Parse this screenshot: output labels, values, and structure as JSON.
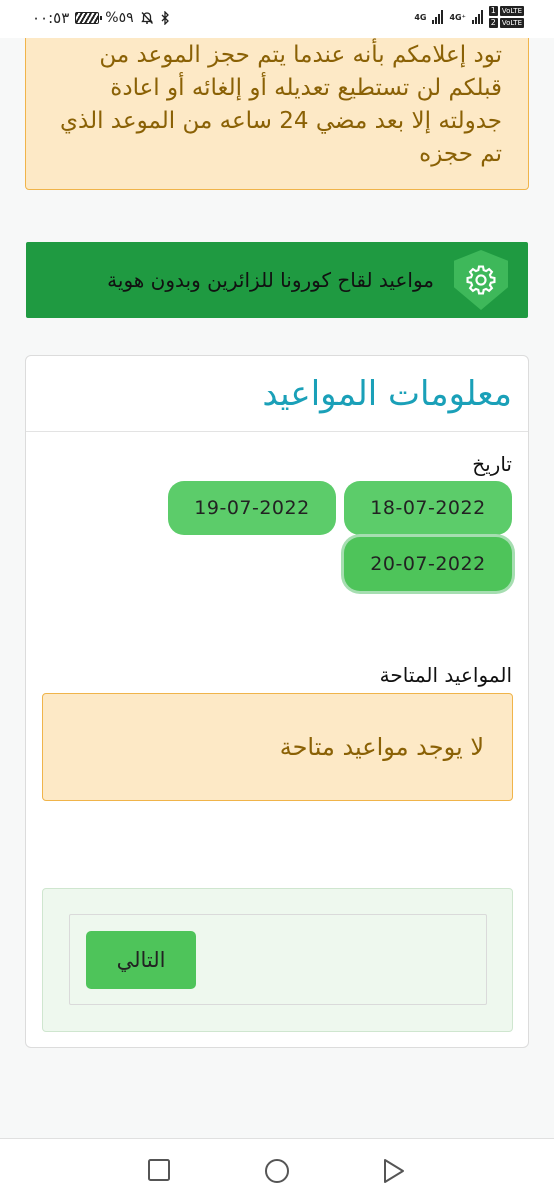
{
  "status_bar": {
    "time": "٠٠:٥٣",
    "battery": "%٥٩",
    "network_1": "4G",
    "network_2": "4G⁺",
    "sim_1": "1",
    "sim_2": "2",
    "volte": "VoLTE"
  },
  "warning": {
    "text": "تود إعلامكم بأنه عندما يتم حجز الموعد من قبلكم لن تستطيع تعديله أو إلغائه أو اعادة جدولته إلا بعد مضي 24 ساعه من الموعد الذي تم حجزه"
  },
  "banner": {
    "text": "مواعيد لقاح كورونا للزائرين وبدون هوية",
    "icon": "gear-icon"
  },
  "card": {
    "title": "معلومات المواعيد",
    "date_label": "تاريخ",
    "dates": [
      "18-07-2022",
      "19-07-2022",
      "20-07-2022"
    ],
    "selected_date": "20-07-2022",
    "slots_label": "المواعيد المتاحة",
    "no_slots": "لا يوجد مواعيد متاحة",
    "next_button": "التالي"
  },
  "colors": {
    "banner_bg": "#1f9a41",
    "title": "#1aa0b8",
    "pill": "#5ccc6a",
    "warning_bg": "#fde9c6",
    "warning_border": "#f0b44a"
  }
}
